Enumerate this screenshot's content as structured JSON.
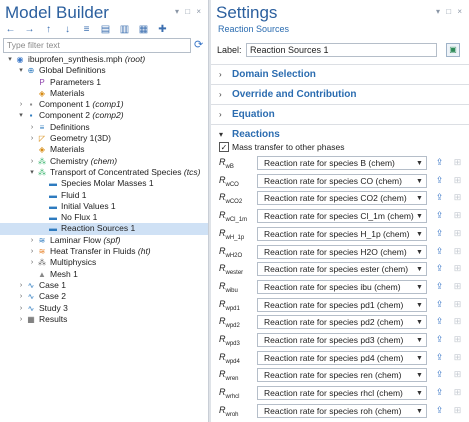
{
  "model_builder": {
    "title": "Model Builder",
    "filter_placeholder": "Type filter text",
    "window_controls": "▾ □ ×",
    "tree": [
      {
        "label": "ibuprofen_synthesis.mph",
        "tag": "(root)",
        "depth": 0,
        "chev": "▾",
        "icon": "◉",
        "color": "#3c78c8"
      },
      {
        "label": "Global Definitions",
        "tag": "",
        "depth": 1,
        "chev": "▾",
        "icon": "⊕",
        "color": "#2e7bbf"
      },
      {
        "label": "Parameters 1",
        "tag": "",
        "depth": 2,
        "chev": "",
        "icon": "P",
        "color": "#8e44ad"
      },
      {
        "label": "Materials",
        "tag": "",
        "depth": 2,
        "chev": "",
        "icon": "◈",
        "color": "#d68910"
      },
      {
        "label": "Component 1",
        "tag": "(comp1)",
        "depth": 1,
        "chev": "›",
        "icon": "▪",
        "color": "#888888"
      },
      {
        "label": "Component 2",
        "tag": "(comp2)",
        "depth": 1,
        "chev": "▾",
        "icon": "▪",
        "color": "#2e7bbf"
      },
      {
        "label": "Definitions",
        "tag": "",
        "depth": 2,
        "chev": "›",
        "icon": "≡",
        "color": "#2e7bbf"
      },
      {
        "label": "Geometry 1(3D)",
        "tag": "",
        "depth": 2,
        "chev": "›",
        "icon": "◸",
        "color": "#d68910"
      },
      {
        "label": "Materials",
        "tag": "",
        "depth": 2,
        "chev": "",
        "icon": "◈",
        "color": "#d68910"
      },
      {
        "label": "Chemistry",
        "tag": "(chem)",
        "depth": 2,
        "chev": "›",
        "icon": "⁂",
        "color": "#27ae60"
      },
      {
        "label": "Transport of Concentrated Species",
        "tag": "(tcs)",
        "depth": 2,
        "chev": "▾",
        "icon": "⁂",
        "color": "#27ae60"
      },
      {
        "label": "Species Molar Masses 1",
        "tag": "",
        "depth": 3,
        "chev": "",
        "icon": "▬",
        "color": "#2e7bbf"
      },
      {
        "label": "Fluid 1",
        "tag": "",
        "depth": 3,
        "chev": "",
        "icon": "▬",
        "color": "#2e7bbf"
      },
      {
        "label": "Initial Values 1",
        "tag": "",
        "depth": 3,
        "chev": "",
        "icon": "▬",
        "color": "#2e7bbf"
      },
      {
        "label": "No Flux 1",
        "tag": "",
        "depth": 3,
        "chev": "",
        "icon": "▬",
        "color": "#2e7bbf"
      },
      {
        "label": "Reaction Sources 1",
        "tag": "",
        "depth": 3,
        "chev": "",
        "icon": "▬",
        "color": "#2e7bbf",
        "selected": true
      },
      {
        "label": "Laminar Flow",
        "tag": "(spf)",
        "depth": 2,
        "chev": "›",
        "icon": "≋",
        "color": "#2e7bbf"
      },
      {
        "label": "Heat Transfer in Fluids",
        "tag": "(ht)",
        "depth": 2,
        "chev": "›",
        "icon": "≋",
        "color": "#e67e22"
      },
      {
        "label": "Multiphysics",
        "tag": "",
        "depth": 2,
        "chev": "›",
        "icon": "⁂",
        "color": "#555555"
      },
      {
        "label": "Mesh 1",
        "tag": "",
        "depth": 2,
        "chev": "",
        "icon": "▲",
        "color": "#888888"
      },
      {
        "label": "Case 1",
        "tag": "",
        "depth": 1,
        "chev": "›",
        "icon": "∿",
        "color": "#2e7bbf"
      },
      {
        "label": "Case 2",
        "tag": "",
        "depth": 1,
        "chev": "›",
        "icon": "∿",
        "color": "#2e7bbf"
      },
      {
        "label": "Study 3",
        "tag": "",
        "depth": 1,
        "chev": "›",
        "icon": "∿",
        "color": "#2e7bbf"
      },
      {
        "label": "Results",
        "tag": "",
        "depth": 1,
        "chev": "›",
        "icon": "▦",
        "color": "#555555"
      }
    ]
  },
  "settings": {
    "title": "Settings",
    "subtitle": "Reaction Sources",
    "window_controls": "▾ □ ×",
    "label_key": "Label:",
    "label_value": "Reaction Sources 1",
    "sections": [
      {
        "chev": "›",
        "title": "Domain Selection"
      },
      {
        "chev": "›",
        "title": "Override and Contribution"
      },
      {
        "chev": "›",
        "title": "Equation"
      },
      {
        "chev": "▾",
        "title": "Reactions"
      }
    ],
    "mass_transfer_label": "Mass transfer to other phases",
    "mass_transfer_checked": "✓",
    "reactions": [
      {
        "sym": "R",
        "sub": "wB",
        "value": "Reaction rate for species B (chem)"
      },
      {
        "sym": "R",
        "sub": "wCO",
        "value": "Reaction rate for species CO (chem)"
      },
      {
        "sym": "R",
        "sub": "wCO2",
        "value": "Reaction rate for species CO2 (chem)"
      },
      {
        "sym": "R",
        "sub": "wCl_1m",
        "value": "Reaction rate for species Cl_1m (chem)"
      },
      {
        "sym": "R",
        "sub": "wH_1p",
        "value": "Reaction rate for species H_1p (chem)"
      },
      {
        "sym": "R",
        "sub": "wH2O",
        "value": "Reaction rate for species H2O (chem)"
      },
      {
        "sym": "R",
        "sub": "wester",
        "value": "Reaction rate for species ester (chem)"
      },
      {
        "sym": "R",
        "sub": "wibu",
        "value": "Reaction rate for species ibu (chem)"
      },
      {
        "sym": "R",
        "sub": "wpd1",
        "value": "Reaction rate for species pd1 (chem)"
      },
      {
        "sym": "R",
        "sub": "wpd2",
        "value": "Reaction rate for species pd2 (chem)"
      },
      {
        "sym": "R",
        "sub": "wpd3",
        "value": "Reaction rate for species pd3 (chem)"
      },
      {
        "sym": "R",
        "sub": "wpd4",
        "value": "Reaction rate for species pd4 (chem)"
      },
      {
        "sym": "R",
        "sub": "wren",
        "value": "Reaction rate for species ren (chem)"
      },
      {
        "sym": "R",
        "sub": "wrhcl",
        "value": "Reaction rate for species rhcl (chem)"
      },
      {
        "sym": "R",
        "sub": "wroh",
        "value": "Reaction rate for species roh (chem)"
      }
    ]
  }
}
